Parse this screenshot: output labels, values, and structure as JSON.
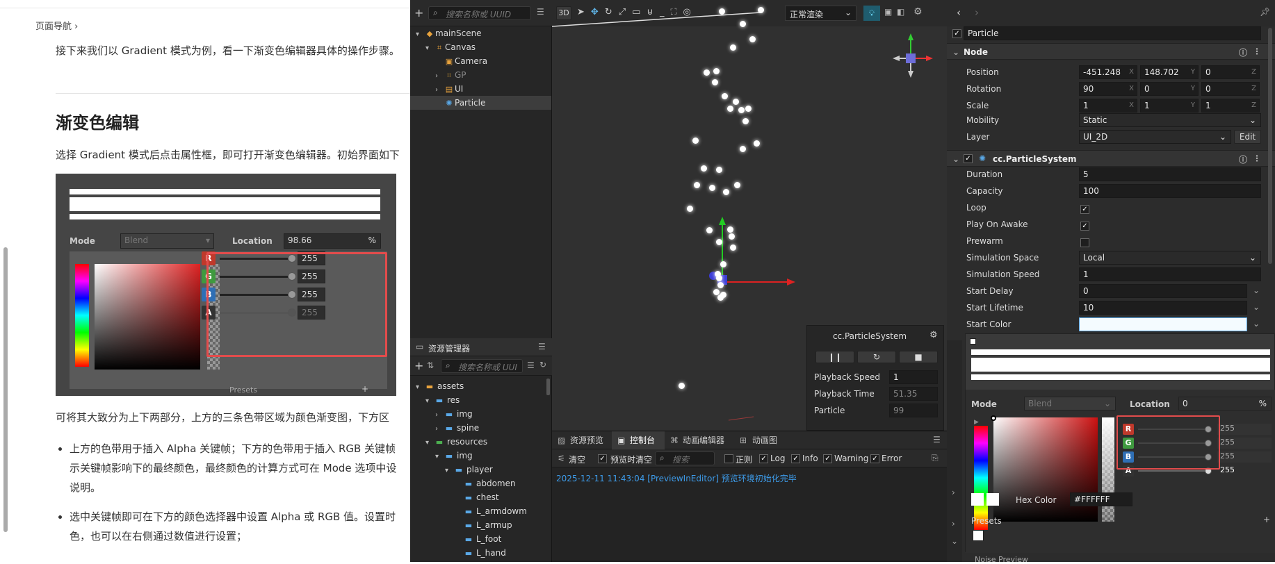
{
  "doc": {
    "breadcrumb": "页面导航",
    "intro": "接下来我们以 Gradient 模式为例，看一下渐变色编辑器具体的操作步骤。",
    "heading": "渐变色编辑",
    "para1": "选择 Gradient 模式后点击属性框，即可打开渐变色编辑器。初始界面如下",
    "para2": "可将其大致分为上下两部分，上方的三条色带区域为颜色渐变图，下方区",
    "bullet1_l1": "上方的色带用于插入 Alpha 关键帧；下方的色带用于插入 RGB 关键帧",
    "bullet1_l2": "示关键帧影响下的最终颜色，最终颜色的计算方式可在 Mode 选项中设",
    "bullet1_l3": "说明。",
    "bullet2_l1": "选中关键帧即可在下方的颜色选择器中设置 Alpha 或 RGB 值。设置时",
    "bullet2_l2": "色，也可以在右侧通过数值进行设置；",
    "figure": {
      "mode_label": "Mode",
      "mode_value": "Blend",
      "location_label": "Location",
      "location_value": "98.66",
      "location_unit": "%",
      "channels": [
        {
          "name": "R",
          "value": "255",
          "color": "#c0392b"
        },
        {
          "name": "G",
          "value": "255",
          "color": "#3f9a3f"
        },
        {
          "name": "B",
          "value": "255",
          "color": "#2f6fb5"
        },
        {
          "name": "A",
          "value": "255",
          "color": "#333333"
        }
      ],
      "presets_label": "Presets",
      "presets_add": "+"
    }
  },
  "hierarchy": {
    "search_placeholder": "搜索名称或 UUID",
    "nodes": [
      "mainScene",
      "Canvas",
      "Camera",
      "GP",
      "UI",
      "Particle"
    ]
  },
  "assets": {
    "title": "资源管理器",
    "search_placeholder": "搜索名称或 UUI",
    "nodes": [
      "assets",
      "res",
      "img",
      "spine",
      "resources",
      "img",
      "player",
      "abdomen",
      "chest",
      "L_armdowm",
      "L_armup",
      "L_foot",
      "L_hand"
    ]
  },
  "scene": {
    "btn_3d": "3D",
    "render_mode": "正常渲染",
    "preview_title": "cc.ParticleSystem",
    "playback_speed_label": "Playback Speed",
    "playback_speed_value": "1",
    "playback_time_label": "Playback Time",
    "playback_time_value": "51.35",
    "particle_label": "Particle",
    "particle_value": "99"
  },
  "console": {
    "tabs": [
      "资源预览",
      "控制台",
      "动画编辑器",
      "动画图"
    ],
    "clear": "清空",
    "clear_on_preview": "预览时清空",
    "search_placeholder": "搜索",
    "regex": "正则",
    "log": "Log",
    "info": "Info",
    "warning": "Warning",
    "error": "Error",
    "message": "2025-12-11 11:43:04 [PreviewInEditor] 预览环境初始化完毕"
  },
  "inspector": {
    "node_name": "Particle",
    "node_section": "Node",
    "position": {
      "label": "Position",
      "x": "-451.248",
      "y": "148.702",
      "z": "0"
    },
    "rotation": {
      "label": "Rotation",
      "x": "90",
      "y": "0",
      "z": "0"
    },
    "scale": {
      "label": "Scale",
      "x": "1",
      "y": "1",
      "z": "1"
    },
    "mobility": {
      "label": "Mobility",
      "value": "Static"
    },
    "layer": {
      "label": "Layer",
      "value": "UI_2D",
      "edit": "Edit"
    },
    "component": "cc.ParticleSystem",
    "duration": {
      "label": "Duration",
      "value": "5"
    },
    "capacity": {
      "label": "Capacity",
      "value": "100"
    },
    "loop": {
      "label": "Loop"
    },
    "play_on_awake": {
      "label": "Play On Awake"
    },
    "prewarm": {
      "label": "Prewarm"
    },
    "simulation_space": {
      "label": "Simulation Space",
      "value": "Local"
    },
    "simulation_speed": {
      "label": "Simulation Speed",
      "value": "1"
    },
    "start_delay": {
      "label": "Start Delay",
      "value": "0"
    },
    "start_lifetime": {
      "label": "Start Lifetime",
      "value": "10"
    },
    "start_color": {
      "label": "Start Color"
    },
    "popup": {
      "mode_label": "Mode",
      "mode_value": "Blend",
      "location_label": "Location",
      "location_value": "0",
      "location_unit": "%",
      "channels": [
        {
          "name": "R",
          "value": "255",
          "color": "#c0392b"
        },
        {
          "name": "G",
          "value": "255",
          "color": "#3f9a3f"
        },
        {
          "name": "B",
          "value": "255",
          "color": "#2f6fb5"
        },
        {
          "name": "A",
          "value": "255",
          "color": "#333333"
        }
      ],
      "hex_label": "Hex Color",
      "hex_value": "#FFFFFF",
      "presets_label": "Presets",
      "presets_add": "+",
      "noise_preview": "Noise Preview"
    }
  }
}
